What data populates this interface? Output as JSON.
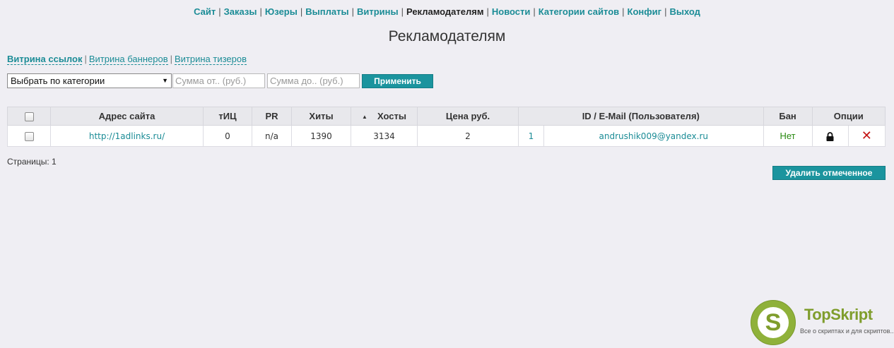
{
  "nav": {
    "items": [
      {
        "label": "Сайт"
      },
      {
        "label": "Заказы"
      },
      {
        "label": "Юзеры"
      },
      {
        "label": "Выплаты"
      },
      {
        "label": "Витрины"
      },
      {
        "label": "Рекламодателям"
      },
      {
        "label": "Новости"
      },
      {
        "label": "Категории сайтов"
      },
      {
        "label": "Конфиг"
      },
      {
        "label": "Выход"
      }
    ],
    "separator": "|"
  },
  "page_title": "Рекламодателям",
  "subtabs": [
    {
      "label": "Витрина ссылок"
    },
    {
      "label": "Витрина баннеров"
    },
    {
      "label": "Витрина тизеров"
    }
  ],
  "filter": {
    "category_selected": "Выбрать по категории",
    "sum_from_placeholder": "Сумма от.. (руб.)",
    "sum_to_placeholder": "Сумма до.. (руб.)",
    "apply_label": "Применить"
  },
  "table": {
    "headers": {
      "site": "Адрес сайта",
      "tic": "тИЦ",
      "pr": "PR",
      "hits": "Хиты",
      "hosts": "Хосты",
      "price": "Цена руб.",
      "id_email": "ID / E-Mail (Пользователя)",
      "ban": "Бан",
      "options": "Опции"
    },
    "rows": [
      {
        "site": "http://1adlinks.ru/",
        "tic": "0",
        "pr": "n/a",
        "hits": "1390",
        "hosts": "3134",
        "price": "2",
        "id": "1",
        "email": "andrushik009@yandex.ru",
        "ban": "Нет"
      }
    ]
  },
  "pages": "Страницы: 1",
  "delete_selected_label": "Удалить отмеченное",
  "logo": {
    "letter": "S",
    "name": "TopSkript",
    "tagline": "Все о скриптах и для скриптов..."
  },
  "colors": {
    "link": "#1b8c96",
    "button": "#1b949e",
    "ban_no": "#2a8a12",
    "delete": "#c41414",
    "logo_green": "#8fb13a"
  },
  "icons": {
    "lock": "lock-icon",
    "delete": "delete-icon",
    "sort": "sort-asc-icon",
    "select_arrow": "chevron-down-icon"
  }
}
